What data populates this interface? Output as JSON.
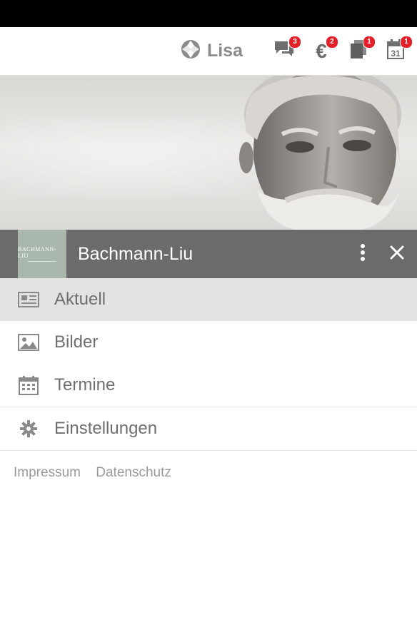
{
  "top_bar": {
    "user_name": "Lisa",
    "icons": [
      {
        "name": "messages-icon",
        "badge": "3"
      },
      {
        "name": "euro-icon",
        "badge": "2"
      },
      {
        "name": "documents-icon",
        "badge": "1"
      },
      {
        "name": "calendar-icon",
        "badge": "1"
      }
    ]
  },
  "header": {
    "logo_text": "BACHMANN-LIU",
    "company_name": "Bachmann-Liu"
  },
  "menu": {
    "items": [
      {
        "label": "Aktuell",
        "icon": "newspaper-icon",
        "active": true
      },
      {
        "label": "Bilder",
        "icon": "image-icon",
        "active": false
      },
      {
        "label": "Termine",
        "icon": "calendar-icon",
        "active": false
      }
    ],
    "settings_label": "Einstellungen"
  },
  "footer": {
    "impressum": "Impressum",
    "datenschutz": "Datenschutz"
  },
  "colors": {
    "badge": "#e3202a",
    "header_strip": "#6b6b6b",
    "logo_bg": "#a9b7ac",
    "active_item": "#e3e3e3"
  }
}
